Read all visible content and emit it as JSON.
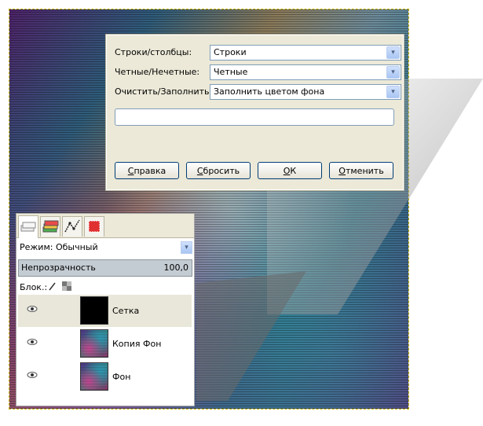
{
  "dialog": {
    "rows": [
      {
        "label": "Строки/столбцы:",
        "value": "Строки"
      },
      {
        "label": "Четные/Нечетные:",
        "value": "Четные"
      },
      {
        "label": "Очистить/Заполнить:",
        "value": "Заполнить цветом фона"
      }
    ],
    "text_value": "",
    "buttons": {
      "help_mnemonic": "С",
      "help_rest": "правка",
      "reset_mnemonic": "С",
      "reset_rest": "бросить",
      "ok_mnemonic": "О",
      "ok_rest": "К",
      "cancel_mnemonic": "О",
      "cancel_rest": "тменить"
    },
    "arrow_glyph": "▾"
  },
  "layers_panel": {
    "tabs": [
      "layers-icon",
      "channels-icon",
      "paths-icon",
      "undo-icon"
    ],
    "mode_label": "Режим: Обычный",
    "opacity_label": "Непрозрачность",
    "opacity_value": "100,0",
    "lock_label": "Блок.:",
    "layers": [
      {
        "name": "Сетка",
        "thumb": "black",
        "selected": true
      },
      {
        "name": "Копия Фон",
        "thumb": "color",
        "selected": false
      },
      {
        "name": "Фон",
        "thumb": "color",
        "selected": false
      }
    ]
  },
  "colors": {
    "dialog_bg": "#ece9d8",
    "border": "#7f9db9",
    "button_border": "#003c74"
  }
}
